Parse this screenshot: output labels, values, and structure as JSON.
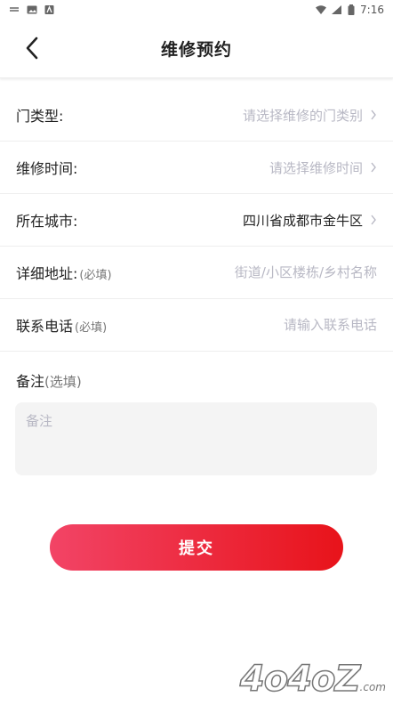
{
  "status_bar": {
    "time": "7:16"
  },
  "header": {
    "title": "维修预约"
  },
  "form": {
    "door_type": {
      "label": "门类型:",
      "placeholder": "请选择维修的门类别"
    },
    "repair_time": {
      "label": "维修时间:",
      "placeholder": "请选择维修时间"
    },
    "city": {
      "label": "所在城市:",
      "value": "四川省成都市金牛区"
    },
    "address": {
      "label": "详细地址:",
      "required_note": "(必填)",
      "placeholder": "街道/小区楼栋/乡村名称"
    },
    "phone": {
      "label": "联系电话",
      "required_note": "(必填)",
      "placeholder": "请输入联系电话"
    },
    "remark": {
      "label": "备注",
      "optional_note": "(选填)",
      "placeholder": "备注"
    }
  },
  "submit_label": "提交",
  "watermark": {
    "text": "4o4oZ",
    "suffix": ".com"
  }
}
